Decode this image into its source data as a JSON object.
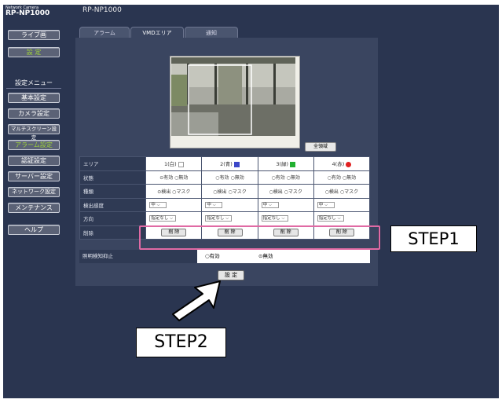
{
  "header": {
    "brand_small": "Network Camera",
    "brand_model": "RP-NP1000",
    "title": "RP-NP1000"
  },
  "sidebar": {
    "live_button": "ライブ画",
    "setup_button": "設 定",
    "menu_header": "設定メニュー",
    "items": [
      {
        "label": "基本設定"
      },
      {
        "label": "カメラ設定"
      },
      {
        "label": "マルチスクリーン設定"
      },
      {
        "label": "アラーム設定"
      },
      {
        "label": "認証設定"
      },
      {
        "label": "サーバー設定"
      },
      {
        "label": "ネットワーク設定"
      },
      {
        "label": "メンテナンス"
      },
      {
        "label": "ヘルプ"
      }
    ]
  },
  "tabs": [
    {
      "label": "アラーム"
    },
    {
      "label": "VMDエリア"
    },
    {
      "label": "通知"
    }
  ],
  "image": {
    "full_button": "全領域"
  },
  "grid": {
    "area_label": "エリア",
    "areas": [
      {
        "label": "1(白)",
        "color": "#ffffff"
      },
      {
        "label": "2(青)",
        "color": "#3c47c8"
      },
      {
        "label": "3(緑)",
        "color": "#22b030"
      },
      {
        "label": "4(赤)",
        "color": "#e02020"
      }
    ],
    "status_label": "状態",
    "on": "有効",
    "off": "無効",
    "type_label": "種類",
    "detect": "検出",
    "mask": "マスク",
    "sensitivity_label": "検出感度",
    "sensitivity_value": "中",
    "direction_label": "方向",
    "direction_value": "指定なし",
    "delete_label": "削除",
    "delete_button": "削 除"
  },
  "no_detect": {
    "label": "照明検知抑止",
    "on": "有効",
    "off": "無効"
  },
  "set_button": "設 定",
  "annotations": {
    "step1": "STEP1",
    "step2": "STEP2"
  }
}
